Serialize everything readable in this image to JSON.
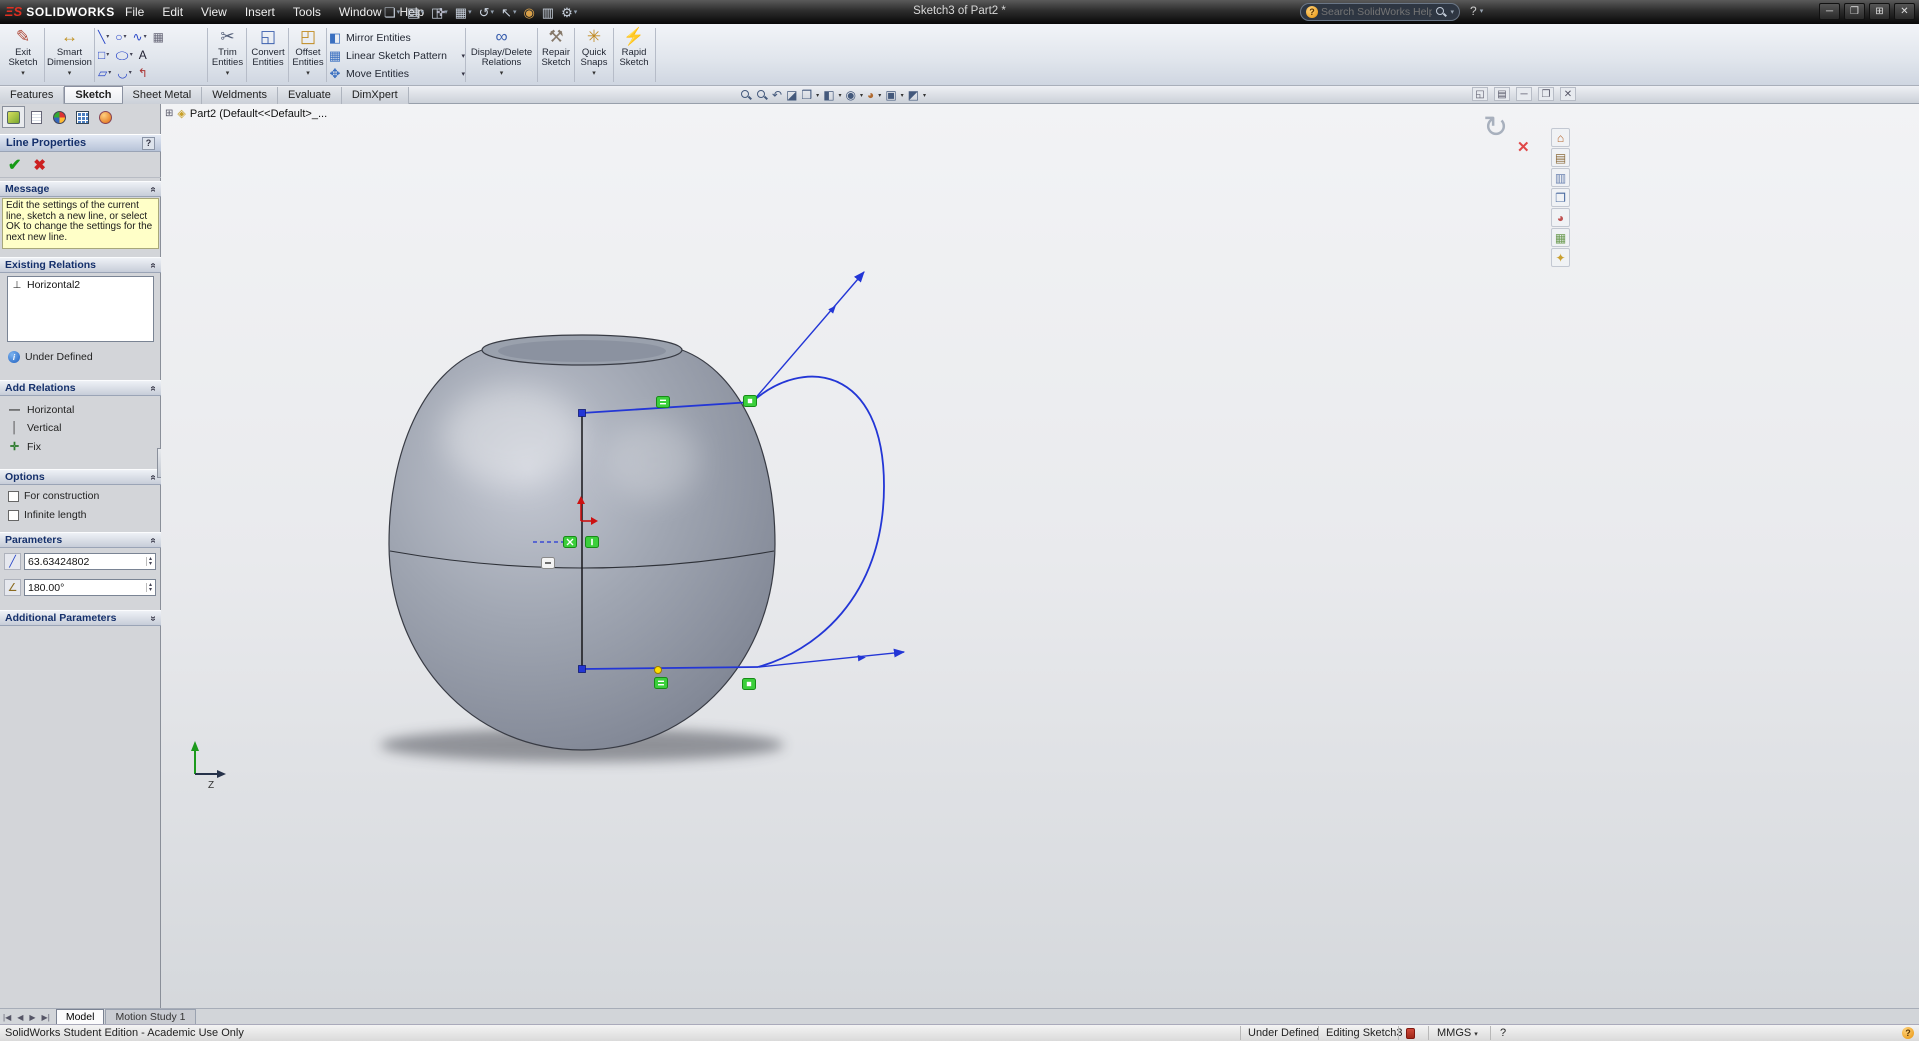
{
  "icons": {
    "caret_down": "▾",
    "chevron": "»",
    "check": "✔",
    "cross": "✖",
    "info_letter": "i",
    "pin": "✜",
    "expander": "⊞",
    "part": "◈",
    "confirm_rotate": "↻",
    "confirm_cancel": "✕",
    "spin_up": "▴",
    "spin_down": "▾"
  },
  "titlebar": {
    "logo_mark": "ΞS",
    "logo_text": "SOLIDWORKS",
    "menus": [
      "File",
      "Edit",
      "View",
      "Insert",
      "Tools",
      "Window",
      "Help"
    ],
    "quick_access": [
      {
        "name": "new-document",
        "glyph": "❏"
      },
      {
        "name": "open",
        "glyph": "▤"
      },
      {
        "name": "save",
        "glyph": "◫"
      },
      {
        "name": "print",
        "glyph": "▦"
      },
      {
        "name": "undo",
        "glyph": "↺"
      },
      {
        "name": "select",
        "glyph": "↖"
      },
      {
        "name": "rebuild",
        "glyph": "◉"
      },
      {
        "name": "file-properties",
        "glyph": "▥"
      },
      {
        "name": "options",
        "glyph": "⚙"
      }
    ],
    "document_title": "Sketch3 of Part2 *",
    "search_placeholder": "Search SolidWorks Help",
    "help_glyph": "?",
    "window_buttons": [
      "─",
      "❐",
      "⊞",
      "✕"
    ]
  },
  "ribbon": {
    "exit_sketch": {
      "label": "Exit Sketch",
      "glyph": "✎"
    },
    "smart_dimension": {
      "label": "Smart Dimension",
      "glyph": "↔"
    },
    "entity_tools": [
      {
        "name": "line",
        "glyph": "╲"
      },
      {
        "name": "circle",
        "glyph": "○"
      },
      {
        "name": "spline",
        "glyph": "∿"
      },
      {
        "name": "point-grid",
        "glyph": "▦"
      },
      {
        "name": "rectangle",
        "glyph": "□"
      },
      {
        "name": "ellipse",
        "glyph": "◯"
      },
      {
        "name": "text",
        "glyph": "A"
      },
      {
        "name": "slot",
        "glyph": "▱"
      },
      {
        "name": "fillet",
        "glyph": "◡"
      },
      {
        "name": "construction-line",
        "glyph": "↰"
      }
    ],
    "trim_entities": {
      "label": "Trim Entities",
      "glyph": "✂"
    },
    "convert_entities": {
      "label": "Convert Entities",
      "glyph": "◱"
    },
    "offset_entities": {
      "label": "Offset Entities",
      "glyph": "◰"
    },
    "mirror_entities": {
      "label": "Mirror Entities",
      "glyph": "◧"
    },
    "linear_pattern": {
      "label": "Linear Sketch Pattern",
      "glyph": "▦"
    },
    "move_entities": {
      "label": "Move Entities",
      "glyph": "✥"
    },
    "display_delete_relations": {
      "label": "Display/Delete Relations",
      "glyph": "∞"
    },
    "repair_sketch": {
      "label": "Repair Sketch",
      "glyph": "⚒"
    },
    "quick_snaps": {
      "label": "Quick Snaps",
      "glyph": "✳"
    },
    "rapid_sketch": {
      "label": "Rapid Sketch",
      "glyph": "⚡"
    }
  },
  "tabs": {
    "items": [
      "Features",
      "Sketch",
      "Sheet Metal",
      "Weldments",
      "Evaluate",
      "DimXpert"
    ],
    "active": "Sketch"
  },
  "hud_icons": [
    {
      "name": "previous-view",
      "glyph": "↶"
    },
    {
      "name": "section-view",
      "glyph": "◪"
    },
    {
      "name": "view-orientation",
      "glyph": "❒"
    },
    {
      "name": "display-style",
      "glyph": "◧"
    },
    {
      "name": "hide-show-items",
      "glyph": "◉"
    },
    {
      "name": "edit-appearance",
      "glyph": "◕"
    },
    {
      "name": "apply-scene",
      "glyph": "▣"
    },
    {
      "name": "view-settings",
      "glyph": "◩"
    }
  ],
  "doc_window_icons": [
    "◱",
    "▤",
    "─",
    "❐",
    "✕"
  ],
  "feature_tree": {
    "root_label": "Part2  (Default<<Default>_..."
  },
  "property_manager": {
    "title": "Line Properties",
    "help_glyph": "?",
    "message": {
      "header": "Message",
      "body": "Edit the settings of the current line, sketch a new line, or select OK to change the settings for the next new line."
    },
    "existing_relations": {
      "header": "Existing Relations",
      "items": [
        {
          "icon": "⊥",
          "label": "Horizontal2"
        }
      ],
      "status": "Under Defined"
    },
    "add_relations": {
      "header": "Add Relations",
      "items": [
        {
          "icon": "—",
          "label": "Horizontal"
        },
        {
          "icon": "│",
          "label": "Vertical"
        },
        {
          "icon": "✛",
          "label": "Fix"
        }
      ]
    },
    "options": {
      "header": "Options",
      "checkboxes": [
        "For construction",
        "Infinite length"
      ]
    },
    "parameters": {
      "header": "Parameters",
      "fields": [
        {
          "icon": "╱",
          "value": "63.63424802"
        },
        {
          "icon": "∠",
          "value": "180.00°"
        }
      ]
    },
    "additional_parameters": {
      "header": "Additional Parameters"
    }
  },
  "task_pane_icons": [
    {
      "name": "solidworks-resources",
      "glyph": "⌂"
    },
    {
      "name": "design-library",
      "glyph": "▤"
    },
    {
      "name": "file-explorer",
      "glyph": "▥"
    },
    {
      "name": "view-palette",
      "glyph": "❐"
    },
    {
      "name": "appearances-scenes",
      "glyph": "◕"
    },
    {
      "name": "custom-properties",
      "glyph": "▦"
    },
    {
      "name": "document-recovery",
      "glyph": "✦"
    }
  ],
  "viewport": {
    "triad_label": "Z"
  },
  "bottom_bar": {
    "nav": [
      "|◀",
      "◀",
      "▶",
      "▶|"
    ],
    "tabs": [
      "Model",
      "Motion Study 1"
    ],
    "active_tab": "Model"
  },
  "statusbar": {
    "left_text": "SolidWorks Student Edition - Academic Use Only",
    "definition_status": "Under Defined",
    "editing_status": "Editing Sketch3",
    "units": "MMGS",
    "help_glyph": "?"
  },
  "colors": {
    "sketch_blue": "#2336d6",
    "relation_green": "#3bcf3b",
    "warning_yellow": "#ffffc8",
    "origin_red": "#cc1111",
    "logo_red": "#e03022"
  }
}
